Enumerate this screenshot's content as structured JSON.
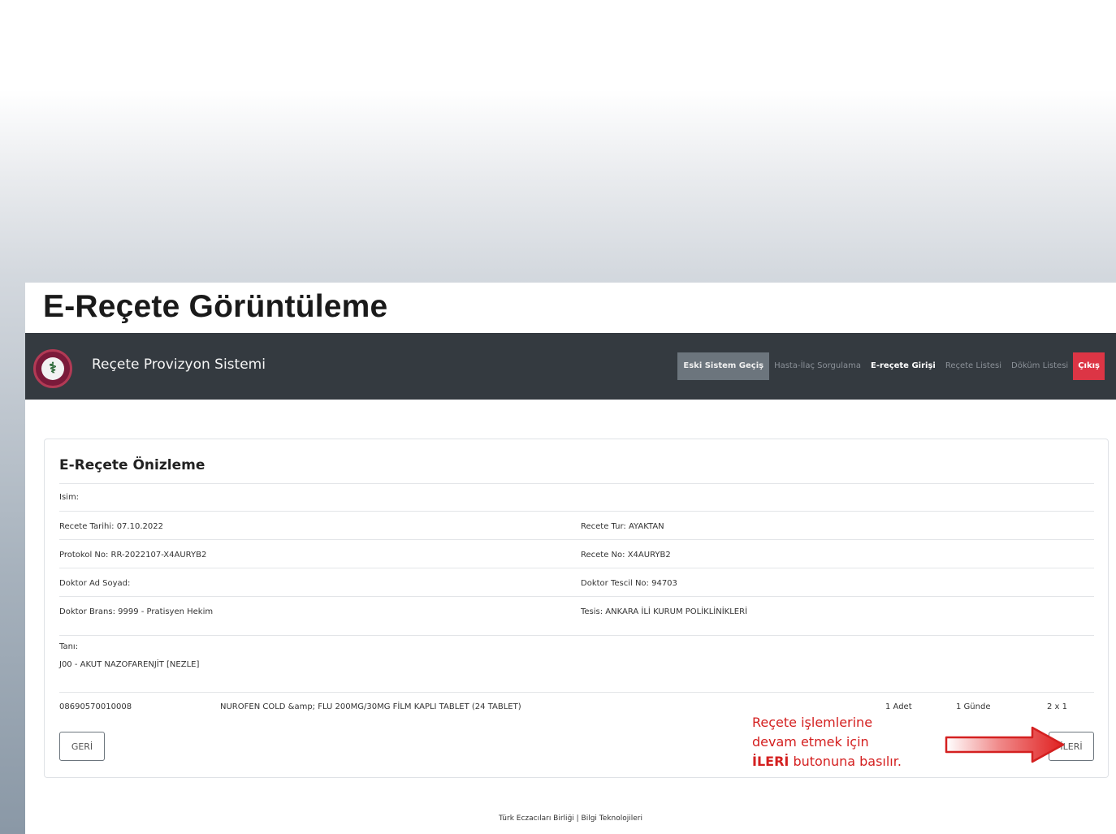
{
  "heading": "E-Reçete Görüntüleme",
  "navbar": {
    "brand": "Reçete Provizyon Sistemi",
    "links": {
      "old_system": "Eski Sistem Geçiş",
      "drug_query": "Hasta-İlaç Sorgulama",
      "erecete_entry": "E-reçete Girişi",
      "recete_list": "Reçete Listesi",
      "dokum_list": "Döküm Listesi",
      "exit": "Çıkış"
    }
  },
  "preview": {
    "title": "E-Reçete Önizleme",
    "isim": "Isim:",
    "recete_tarihi": "Recete Tarihi: 07.10.2022",
    "recete_tur": "Recete Tur: AYAKTAN",
    "protokol_no": "Protokol No: RR-2022107-X4AURYB2",
    "recete_no": "Recete No: X4AURYB2",
    "doktor_ad": "Doktor Ad Soyad:",
    "doktor_tescil": "Doktor Tescil No: 94703",
    "doktor_brans": "Doktor Brans: 9999 - Pratisyen Hekim",
    "tesis": "Tesis: ANKARA İLİ KURUM POLİKLİNİKLERİ",
    "tani_label": "Tanı:",
    "tani_value": "J00 - AKUT NAZOFARENJİT [NEZLE]"
  },
  "drug": {
    "barcode": "08690570010008",
    "name": "NUROFEN COLD &amp; FLU 200MG/30MG FİLM KAPLI TABLET (24 TABLET)",
    "quantity": "1 Adet",
    "period": "1 Günde",
    "dosage": "2 x 1"
  },
  "buttons": {
    "back": "GERİ",
    "next": "İLERİ"
  },
  "note": {
    "line1": "Reçete işlemlerine",
    "line2": "devam etmek için",
    "bold": "İLERİ",
    "line3_rest": " butonuna basılır."
  },
  "footer": "Türk Eczacıları Birliği | Bilgi Teknolojileri",
  "colors": {
    "navbar": "#343a40",
    "exit": "#dc3545",
    "annotation": "#d42020"
  }
}
